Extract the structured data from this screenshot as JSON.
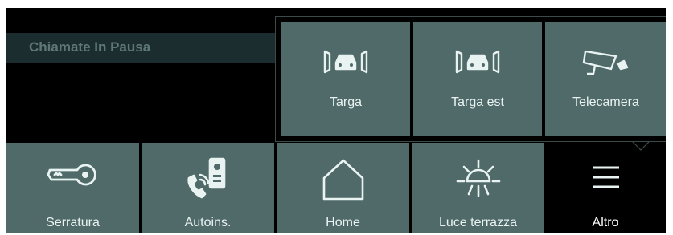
{
  "status": {
    "text": "Chiamate In Pausa"
  },
  "popup": {
    "items": [
      {
        "label": "Targa",
        "icon": "gate-car-icon"
      },
      {
        "label": "Targa est",
        "icon": "gate-car-icon"
      },
      {
        "label": "Telecamera",
        "icon": "camera-icon"
      }
    ]
  },
  "bottom_bar": {
    "items": [
      {
        "label": "Serratura",
        "icon": "key-icon"
      },
      {
        "label": "Autoins.",
        "icon": "intercom-call-icon"
      },
      {
        "label": "Home",
        "icon": "home-icon"
      },
      {
        "label": "Luce terrazza",
        "icon": "light-icon"
      },
      {
        "label": "Altro",
        "icon": "menu-icon"
      }
    ]
  },
  "colors": {
    "tile": "#4f6a69",
    "status_bg": "#1b2d2e",
    "status_text": "#5f7777",
    "icon_stroke": "#e9f3f2"
  }
}
